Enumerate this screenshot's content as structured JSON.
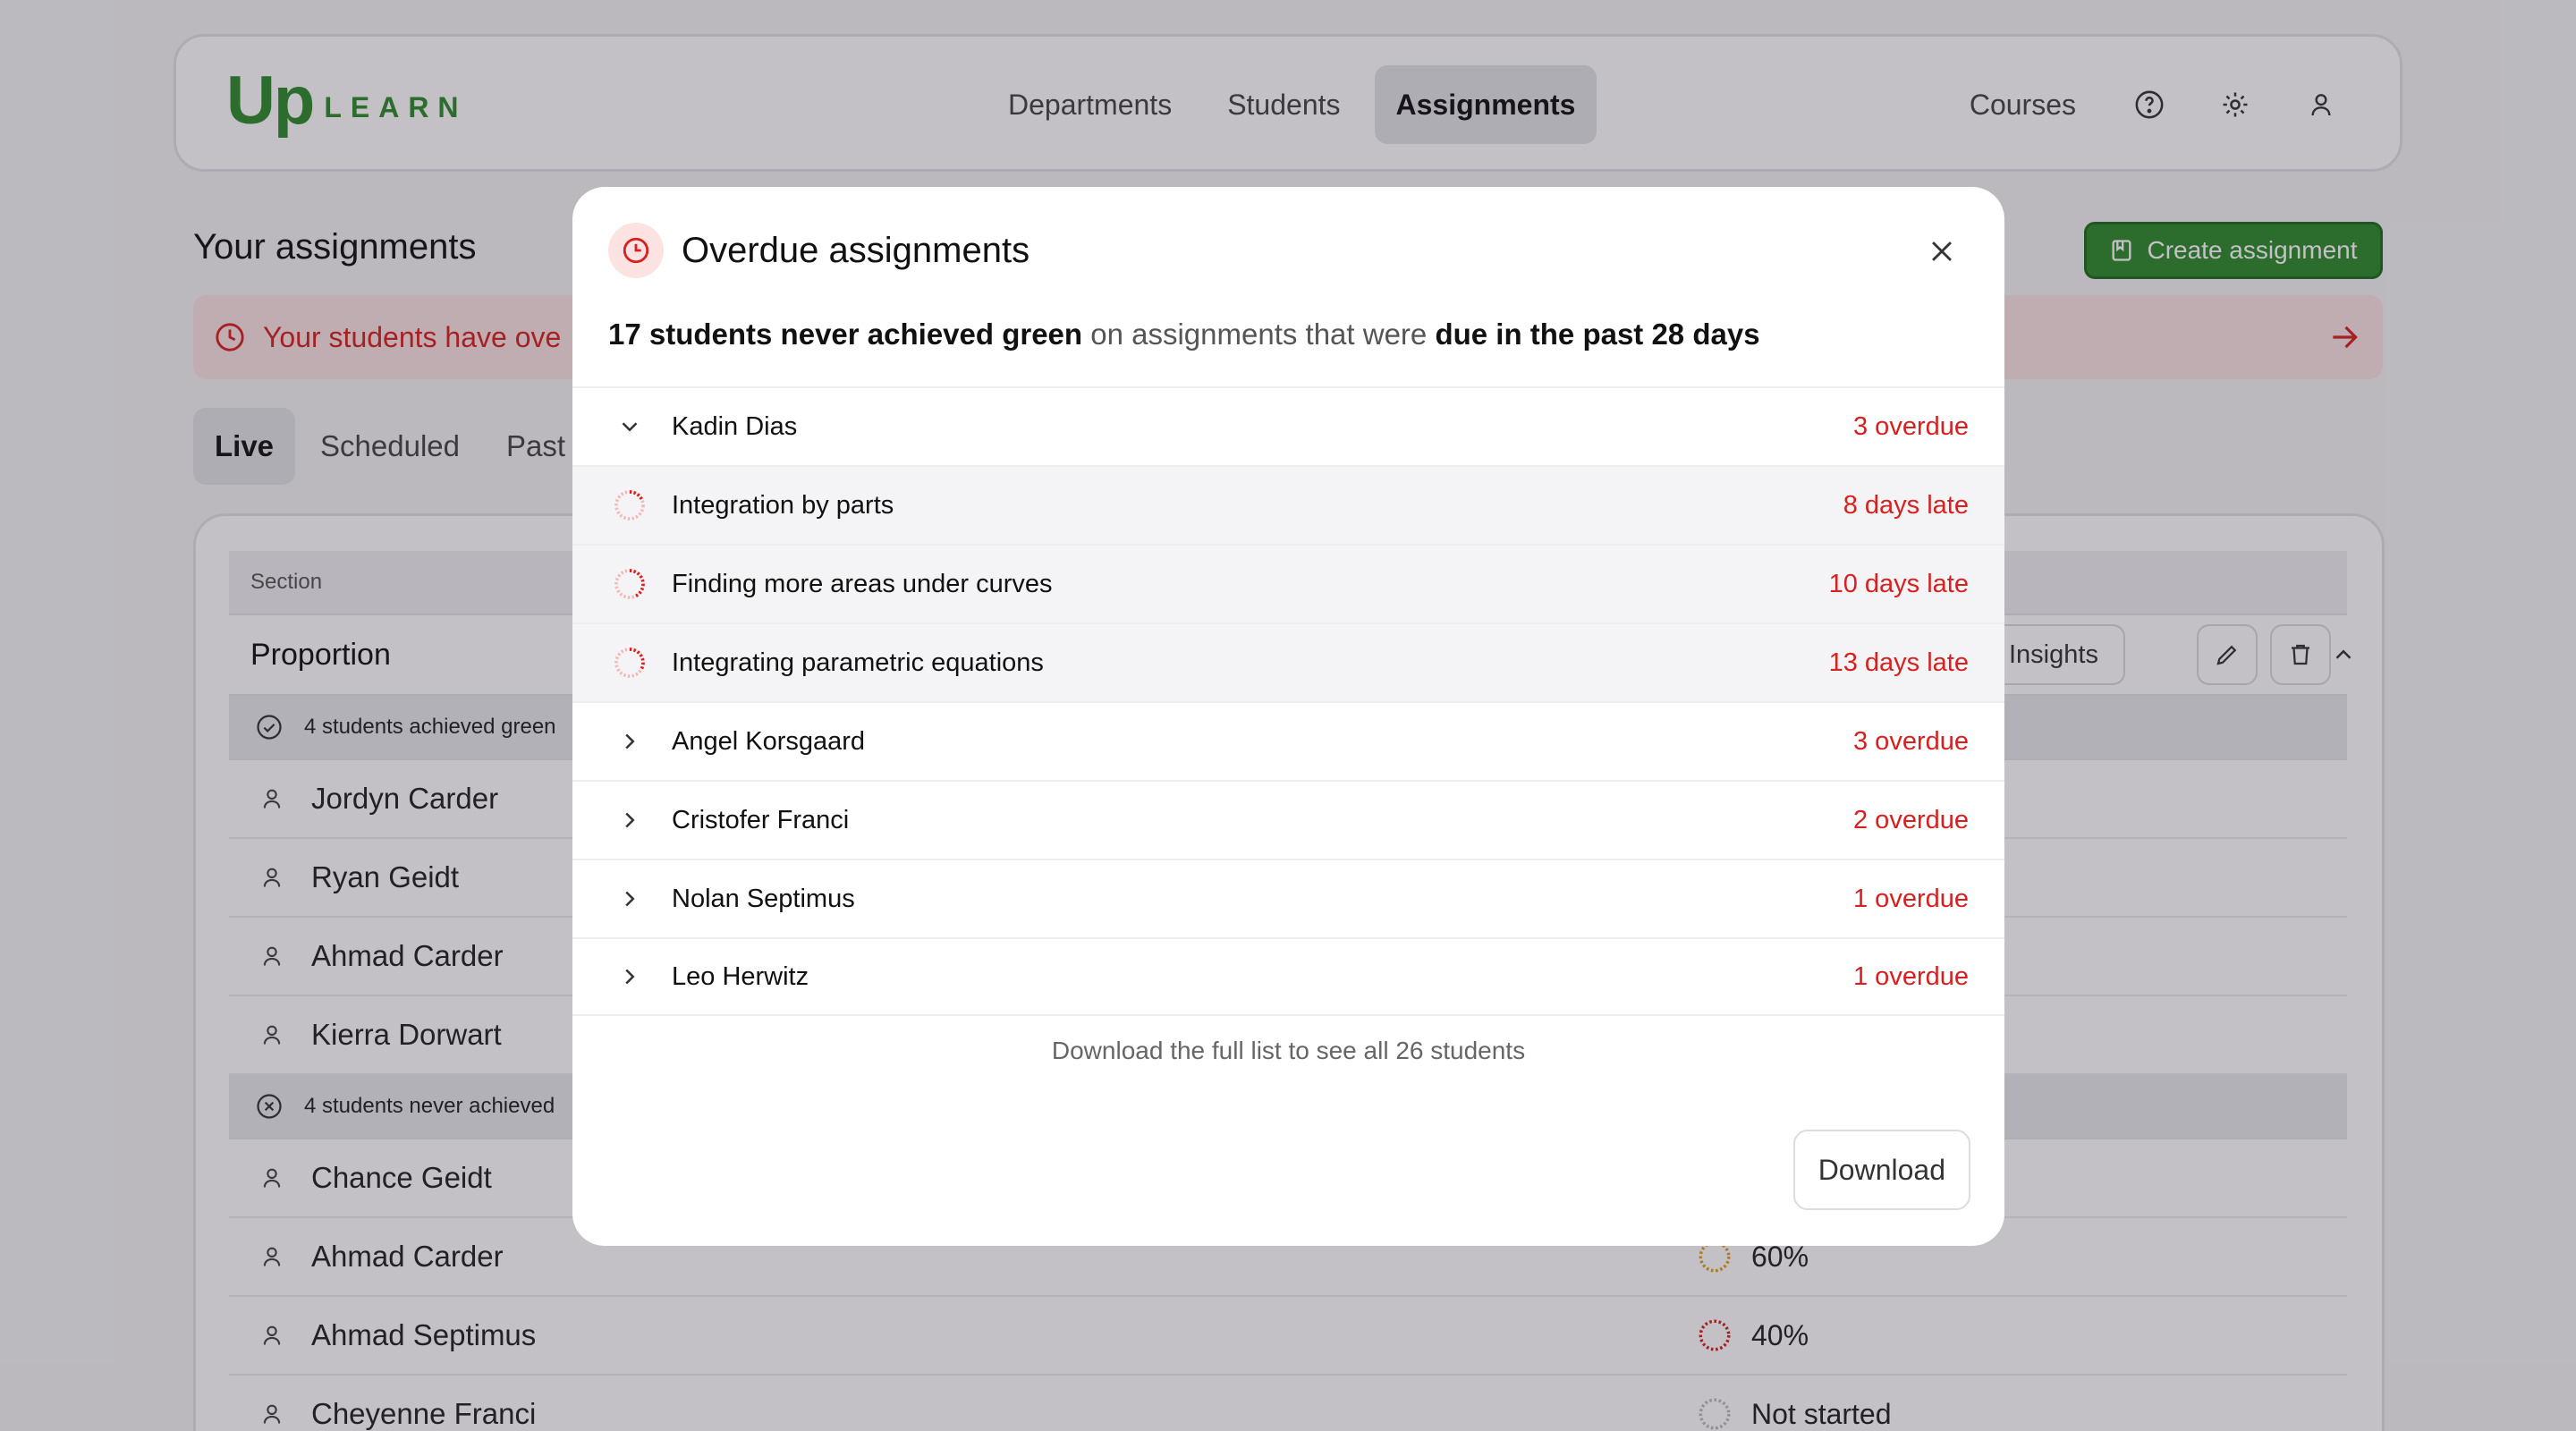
{
  "app": {
    "logo_up": "Up",
    "logo_learn": "LEARN"
  },
  "nav": {
    "items": [
      "Departments",
      "Students",
      "Assignments"
    ],
    "active": "Assignments",
    "courses": "Courses"
  },
  "page": {
    "title": "Your assignments",
    "create_button": "Create assignment",
    "alert_text": "Your students have ove",
    "tabs": [
      "Live",
      "Scheduled",
      "Past"
    ]
  },
  "table": {
    "header": "Section",
    "section_name": "Proportion",
    "insights_label": "Insights",
    "group_achieved": "4 students achieved green",
    "group_never": "4 students never achieved",
    "achieved_students": [
      "Jordyn Carder",
      "Ryan Geidt",
      "Ahmad Carder",
      "Kierra Dorwart"
    ],
    "never_students": [
      {
        "name": "Chance Geidt",
        "progress": ""
      },
      {
        "name": "Ahmad Carder",
        "progress": "60%"
      },
      {
        "name": "Ahmad Septimus",
        "progress": "40%"
      },
      {
        "name": "Cheyenne Franci",
        "progress": "Not started"
      }
    ]
  },
  "modal": {
    "title": "Overdue assignments",
    "summary_bold1": "17 students never achieved green",
    "summary_mid": " on assignments that were ",
    "summary_bold2": "due in the past 28 days",
    "rows": [
      {
        "type": "student",
        "label": "Kadin Dias",
        "right": "3 overdue",
        "expanded": true
      },
      {
        "type": "assignment",
        "label": "Integration by parts",
        "right": "8 days late",
        "level": 0.2
      },
      {
        "type": "assignment",
        "label": "Finding more areas under curves",
        "right": "10 days late",
        "level": 0.5
      },
      {
        "type": "assignment",
        "label": "Integrating parametric equations",
        "right": "13 days late",
        "level": 0.4
      },
      {
        "type": "student",
        "label": "Angel Korsgaard",
        "right": "3 overdue",
        "expanded": false
      },
      {
        "type": "student",
        "label": "Cristofer Franci",
        "right": "2 overdue",
        "expanded": false
      },
      {
        "type": "student",
        "label": "Nolan Septimus",
        "right": "1 overdue",
        "expanded": false
      },
      {
        "type": "student",
        "label": "Leo Herwitz",
        "right": "1 overdue",
        "expanded": false
      }
    ],
    "footnote": "Download the full list to see all 26 students",
    "download_button": "Download"
  },
  "colors": {
    "brand_green": "#2e8b2e",
    "overdue_red": "#d72020",
    "warning_orange": "#e0a020"
  }
}
